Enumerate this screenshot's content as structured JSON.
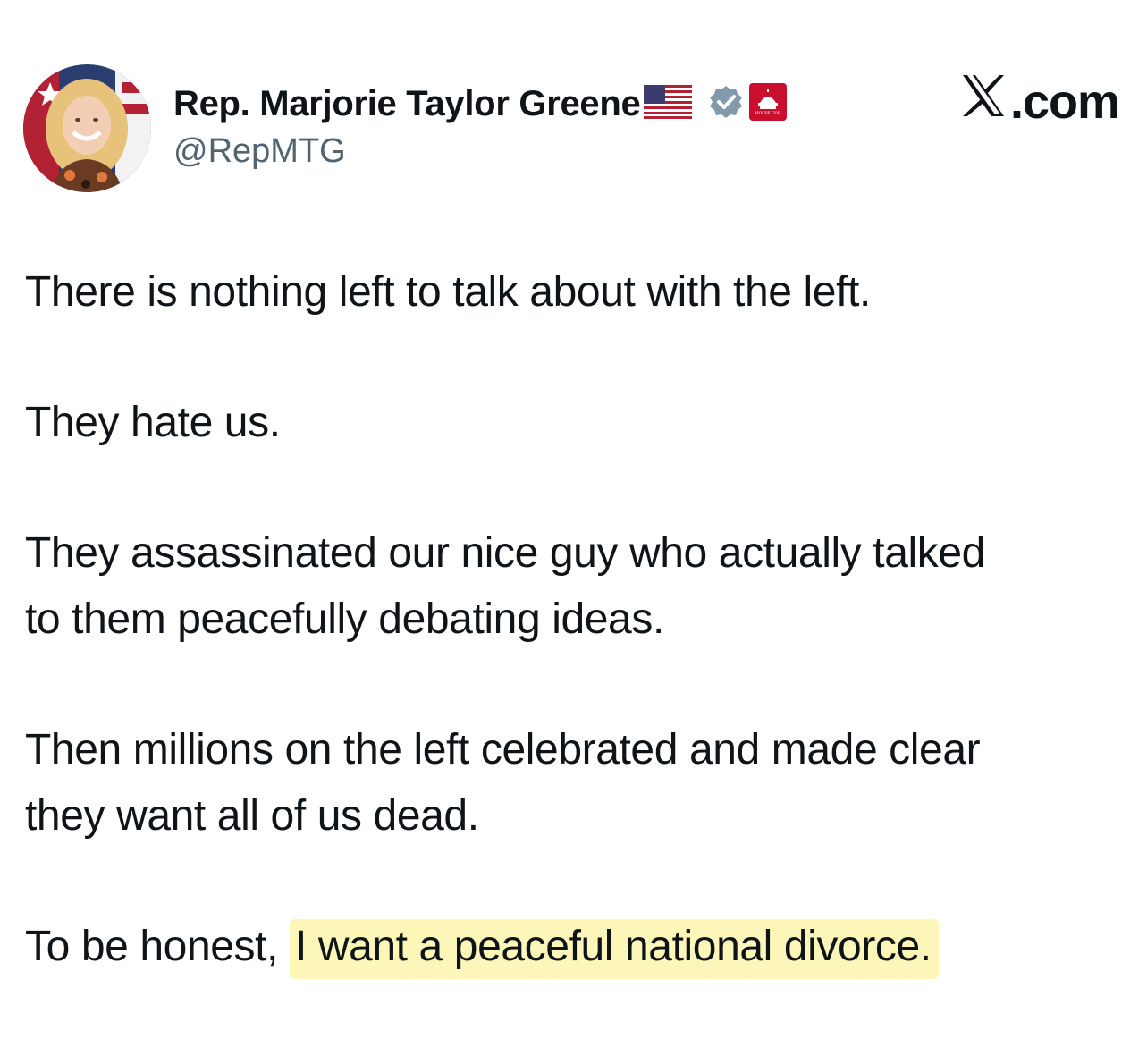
{
  "author": {
    "display_name": "Rep. Marjorie Taylor Greene",
    "handle": "@RepMTG",
    "badges": [
      "us-flag-icon",
      "verified-badge-icon",
      "house-gop-badge-icon"
    ],
    "house_gop_badge_text": "HOUSE GOP"
  },
  "brand": {
    "label": ".com",
    "logo": "x-logo-icon"
  },
  "tweet": {
    "paragraph_1": "There is nothing left to talk about with the left.",
    "paragraph_2": "They hate us.",
    "paragraph_3": "They assassinated our nice guy who actually talked to them peacefully debating ideas.",
    "paragraph_4": "Then millions on the left celebrated and made clear they want all of us dead.",
    "paragraph_5_prefix": "To be honest, ",
    "paragraph_5_highlight": "I want a peaceful national divorce."
  },
  "colors": {
    "text": "#0f1419",
    "handle": "#536471",
    "verified_badge": "#829aab",
    "gop_badge": "#c8102e",
    "highlight": "#fcf7b8"
  }
}
